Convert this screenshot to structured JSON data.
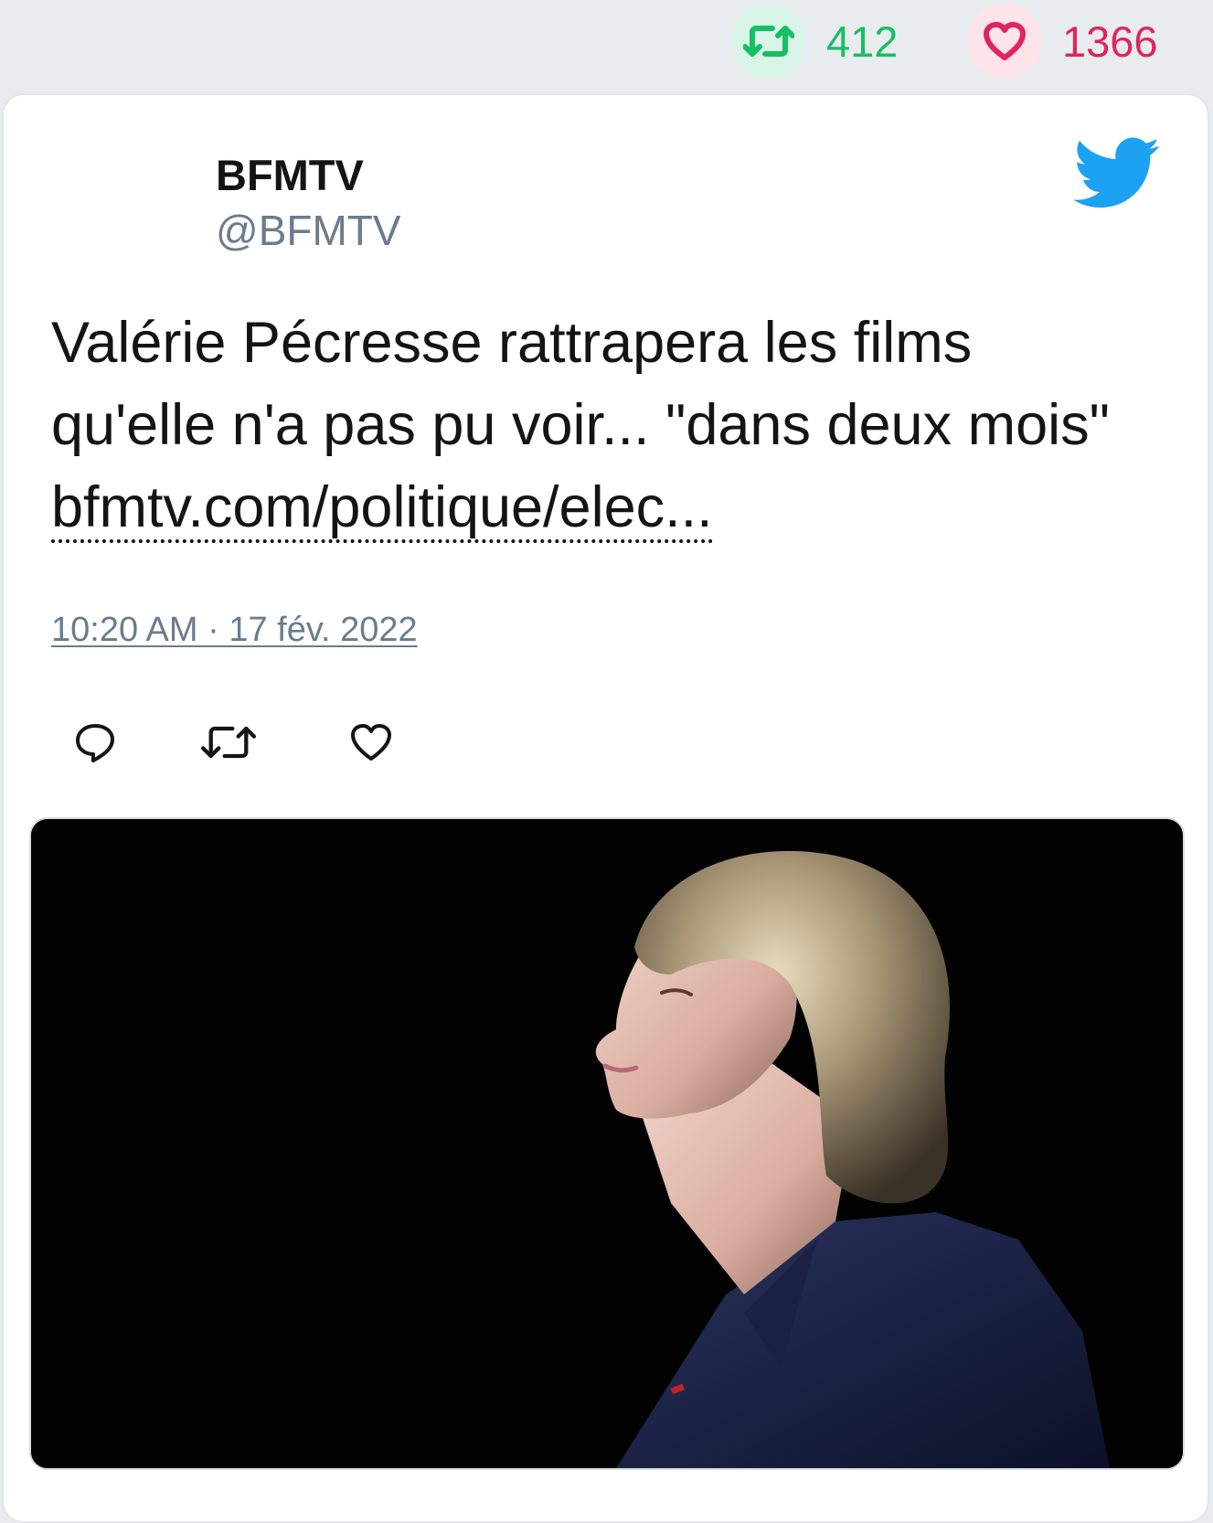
{
  "stats": {
    "retweet_icon": "retweet-icon",
    "retweet_count": "412",
    "retweet_color": "#17bf63",
    "like_icon": "heart-icon",
    "like_count": "1366",
    "like_color": "#e0245e"
  },
  "tweet": {
    "author_name": "BFMTV",
    "author_handle": "@BFMTV",
    "brand_icon": "twitter-bird-icon",
    "brand_color": "#1da1f2",
    "text": "Valérie Pécresse rattrapera les films qu'elle n'a pas pu voir... \"dans deux mois\" ",
    "link_text": "bfmtv.com/politique/elec...",
    "timestamp": "10:20 AM · 17 fév. 2022"
  },
  "actions": [
    {
      "name": "reply",
      "icon": "reply-icon"
    },
    {
      "name": "retweet",
      "icon": "retweet-icon"
    },
    {
      "name": "like",
      "icon": "heart-icon"
    }
  ],
  "media": {
    "type": "photo",
    "background_color": "#020202"
  }
}
